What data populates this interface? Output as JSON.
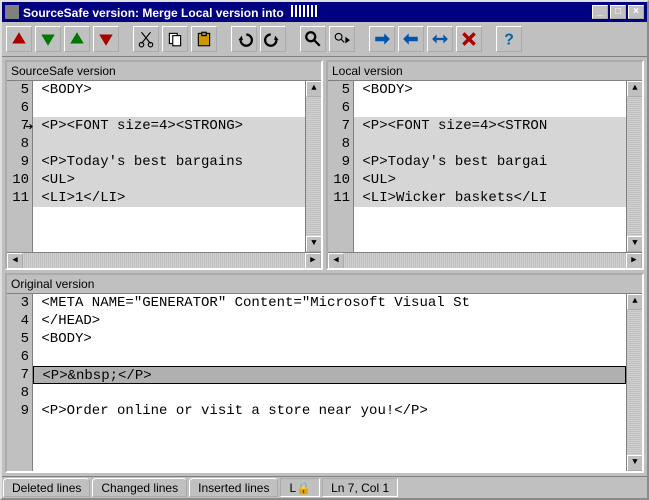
{
  "title": "SourceSafe version: Merge Local version into",
  "wincontrols": {
    "min": "_",
    "max": "□",
    "close": "×"
  },
  "toolbar_icons": [
    "nav-up-red",
    "nav-down-green",
    "nav-up-green",
    "nav-down-red",
    "gap",
    "cut",
    "copy",
    "paste",
    "gap",
    "undo",
    "redo",
    "gap",
    "find",
    "find-next",
    "gap",
    "merge-right",
    "merge-left",
    "merge-both",
    "merge-cancel",
    "gap",
    "help"
  ],
  "panes": {
    "left": {
      "title": "SourceSafe version",
      "current_marker_line": 7,
      "lines": [
        {
          "n": "5",
          "text": " <BODY>",
          "hl": ""
        },
        {
          "n": "6",
          "text": "",
          "hl": ""
        },
        {
          "n": "7",
          "text": " <P><FONT size=4><STRONG>",
          "hl": "ins"
        },
        {
          "n": "8",
          "text": "",
          "hl": "ins"
        },
        {
          "n": "9",
          "text": " <P>Today's best bargains",
          "hl": "ins"
        },
        {
          "n": "10",
          "text": " <UL>",
          "hl": "ins"
        },
        {
          "n": "11",
          "text": " <LI>1</LI>",
          "hl": "ins"
        }
      ]
    },
    "right": {
      "title": "Local version",
      "lines": [
        {
          "n": "5",
          "text": " <BODY>",
          "hl": ""
        },
        {
          "n": "6",
          "text": "",
          "hl": ""
        },
        {
          "n": "7",
          "text": " <P><FONT size=4><STRON",
          "hl": "ins"
        },
        {
          "n": "8",
          "text": "",
          "hl": "ins"
        },
        {
          "n": "9",
          "text": " <P>Today's best bargai",
          "hl": "ins"
        },
        {
          "n": "10",
          "text": " <UL>",
          "hl": "ins"
        },
        {
          "n": "11",
          "text": " <LI>Wicker baskets</LI",
          "hl": "ins"
        }
      ]
    },
    "bottom": {
      "title": "Original version",
      "lines": [
        {
          "n": "3",
          "text": " <META NAME=\"GENERATOR\" Content=\"Microsoft Visual St",
          "hl": ""
        },
        {
          "n": "4",
          "text": " </HEAD>",
          "hl": ""
        },
        {
          "n": "5",
          "text": " <BODY>",
          "hl": ""
        },
        {
          "n": "6",
          "text": "",
          "hl": ""
        },
        {
          "n": "7",
          "text": " <P>&nbsp;</P>",
          "hl": "sel"
        },
        {
          "n": "8",
          "text": "",
          "hl": ""
        },
        {
          "n": "9",
          "text": " <P>Order online or visit a store near you!</P>",
          "hl": ""
        }
      ]
    }
  },
  "status": {
    "tabs": [
      "Deleted lines",
      "Changed lines",
      "Inserted lines"
    ],
    "lock_icon": "L🔒",
    "pos": "Ln 7, Col 1"
  }
}
